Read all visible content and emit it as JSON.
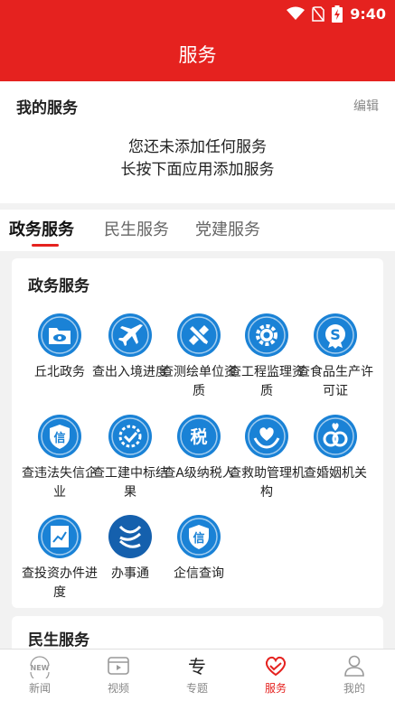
{
  "status_bar": {
    "time": "9:40"
  },
  "header": {
    "title": "服务"
  },
  "my_services": {
    "title": "我的服务",
    "edit_label": "编辑",
    "empty_line1": "您还未添加任何服务",
    "empty_line2": "长按下面应用添加服务"
  },
  "tabs": [
    {
      "label": "政务服务",
      "active": true
    },
    {
      "label": "民生服务",
      "active": false
    },
    {
      "label": "党建服务",
      "active": false
    }
  ],
  "government_card": {
    "title": "政务服务",
    "items": [
      {
        "label": "丘北政务",
        "icon": "folder-eye-icon"
      },
      {
        "label": "查出入境进度",
        "icon": "airplane-icon"
      },
      {
        "label": "查测绘单位资质",
        "icon": "ruler-pencil-icon"
      },
      {
        "label": "查工程监理资质",
        "icon": "gear-icon"
      },
      {
        "label": "查食品生产许可证",
        "icon": "s-badge-icon"
      },
      {
        "label": "查违法失信企业",
        "icon": "shield-xin-icon"
      },
      {
        "label": "查工建中标结果",
        "icon": "gear-check-icon"
      },
      {
        "label": "查A级纳税人",
        "icon": "tax-icon"
      },
      {
        "label": "查救助管理机构",
        "icon": "heart-hands-icon"
      },
      {
        "label": "查婚姻机关",
        "icon": "rings-icon"
      },
      {
        "label": "查投资办件进度",
        "icon": "chart-doc-icon"
      },
      {
        "label": "办事通",
        "icon": "bantong-logo-icon"
      },
      {
        "label": "企信查询",
        "icon": "shield-xin-icon"
      }
    ]
  },
  "livelihood_card": {
    "title": "民生服务"
  },
  "bottom_nav": [
    {
      "label": "新闻",
      "icon": "news-icon",
      "active": false
    },
    {
      "label": "视频",
      "icon": "video-icon",
      "active": false
    },
    {
      "label": "专题",
      "icon": "topic-icon",
      "active": false
    },
    {
      "label": "服务",
      "icon": "service-heart-icon",
      "active": true
    },
    {
      "label": "我的",
      "icon": "profile-icon",
      "active": false
    }
  ],
  "colors": {
    "brand_red": "#e5221f",
    "icon_blue": "#1a82d6",
    "icon_dark_blue": "#1560ad"
  }
}
